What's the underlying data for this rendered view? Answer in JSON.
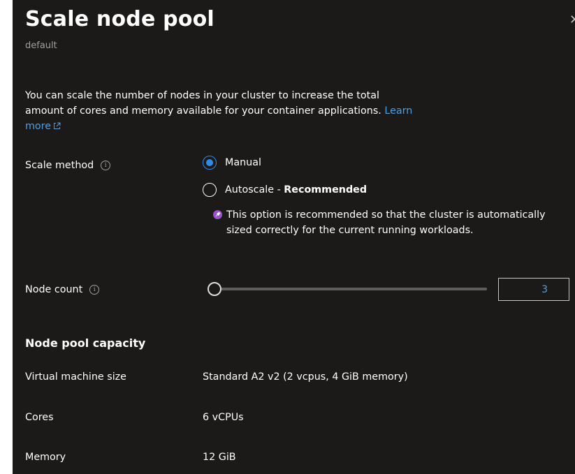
{
  "header": {
    "title": "Scale node pool",
    "subtitle": "default"
  },
  "description": {
    "text": "You can scale the number of nodes in your cluster to increase the total amount of cores and memory available for your container applications.",
    "learn_more": "Learn more"
  },
  "scale_method": {
    "label": "Scale method",
    "options": [
      {
        "label": "Manual",
        "selected": true
      },
      {
        "label": "Autoscale - ",
        "suffix_bold": "Recommended",
        "selected": false
      }
    ],
    "recommendation": "This option is recommended so that the cluster is automatically sized correctly for the current running workloads."
  },
  "node_count": {
    "label": "Node count",
    "value": "3",
    "slider_fraction": 0
  },
  "capacity": {
    "heading": "Node pool capacity",
    "rows": [
      {
        "label": "Virtual machine size",
        "value": "Standard A2 v2 (2 vcpus, 4 GiB memory)"
      },
      {
        "label": "Cores",
        "value": "6 vCPUs"
      },
      {
        "label": "Memory",
        "value": "12 GiB"
      }
    ]
  },
  "colors": {
    "panel_background": "#1b1a19",
    "accent": "#2f8ce6",
    "link": "#4f9fe3",
    "recommend_badge": "#9b4fd1"
  },
  "icons": {
    "close": "close-icon",
    "info": "info-icon",
    "external_link": "external-link-icon",
    "recommend": "rocket-icon"
  }
}
